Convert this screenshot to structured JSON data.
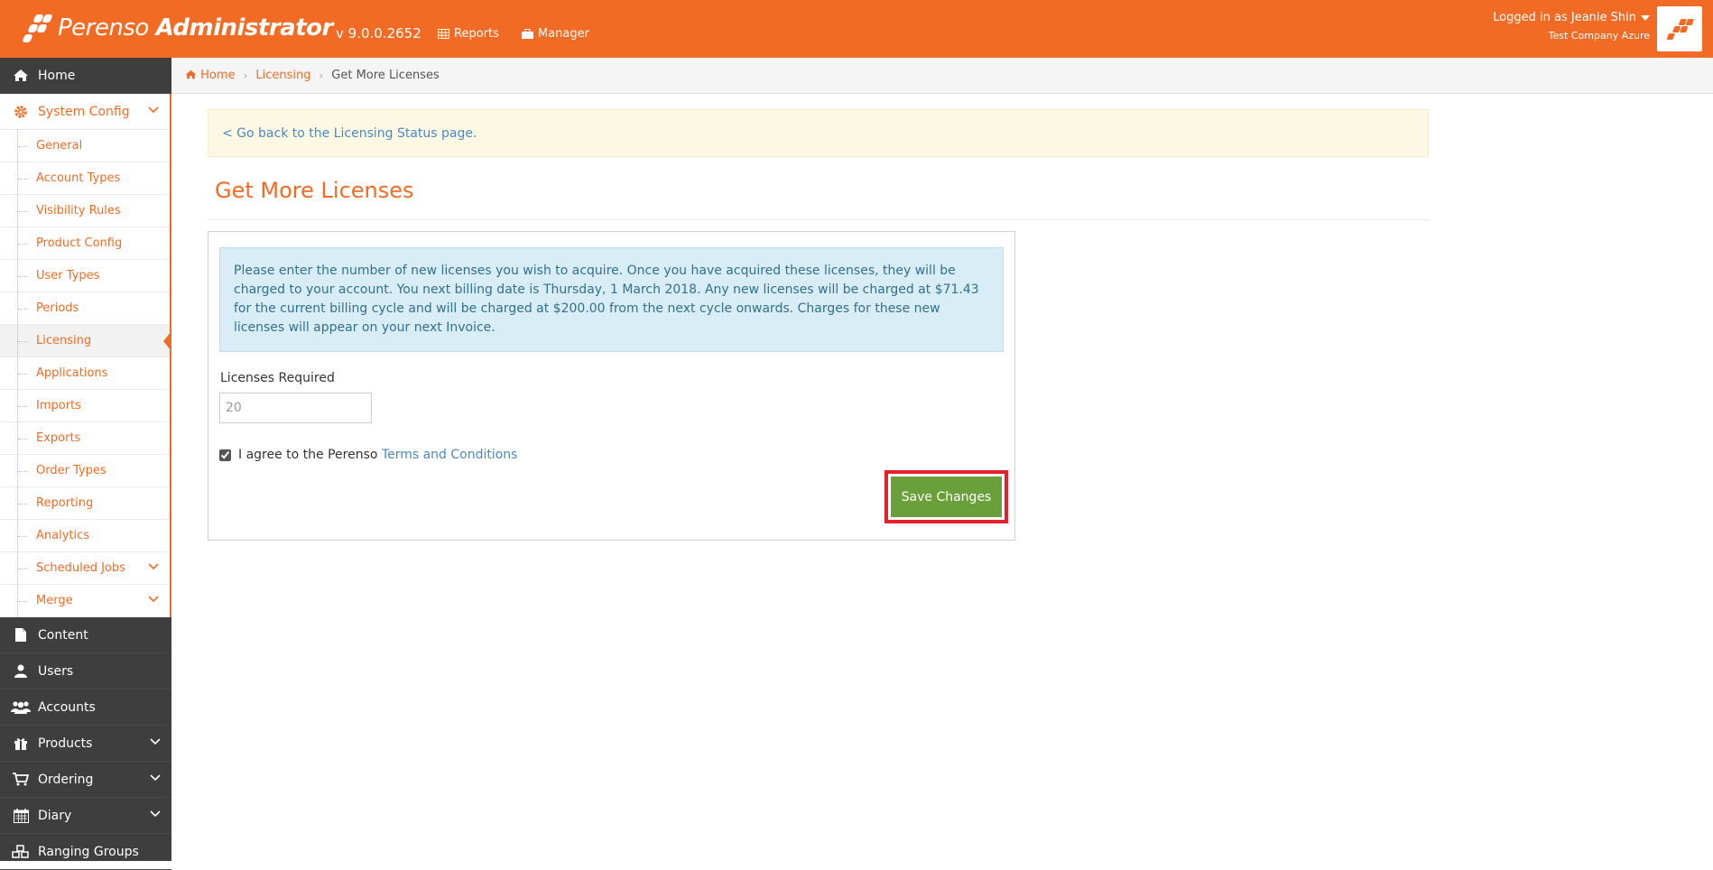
{
  "app": {
    "logo_name": "Perenso",
    "logo_suffix": "Administrator",
    "version": "v 9.0.0.2652",
    "topnav": [
      {
        "label": "Reports",
        "icon": "table-icon"
      },
      {
        "label": "Manager",
        "icon": "briefcase-icon"
      }
    ],
    "user_line": "Logged in as Jeanie Shin",
    "company": "Test Company Azure",
    "brand_color": "#f26b24"
  },
  "sidebar": {
    "home": "Home",
    "system_config": "System Config",
    "sub_items": [
      "General",
      "Account Types",
      "Visibility Rules",
      "Product Config",
      "User Types",
      "Periods",
      "Licensing",
      "Applications",
      "Imports",
      "Exports",
      "Order Types",
      "Reporting",
      "Analytics",
      "Scheduled Jobs",
      "Merge"
    ],
    "active_sub": "Licensing",
    "bottom_items": [
      "Content",
      "Users",
      "Accounts",
      "Products",
      "Ordering",
      "Diary",
      "Ranging Groups"
    ]
  },
  "breadcrumb": {
    "home": "Home",
    "licensing": "Licensing",
    "current": "Get More Licenses"
  },
  "main": {
    "back_link": "< Go back to the Licensing Status page.",
    "title": "Get More Licenses",
    "info_text": "Please enter the number of new licenses you wish to acquire. Once you have acquired these licenses, they will be charged to your account. You next billing date is Thursday, 1 March 2018. Any new licenses will be charged at $71.43 for the current billing cycle and will be charged at $200.00 from the next cycle onwards. Charges for these new licenses will appear on your next Invoice.",
    "licenses_label": "Licenses Required",
    "licenses_value": "20",
    "agree_text": "I agree to the Perenso",
    "terms_link": "Terms and Conditions",
    "agree_checked": true,
    "save_label": "Save Changes",
    "save_color": "#6aa03a",
    "highlight_color": "#e3212b"
  }
}
